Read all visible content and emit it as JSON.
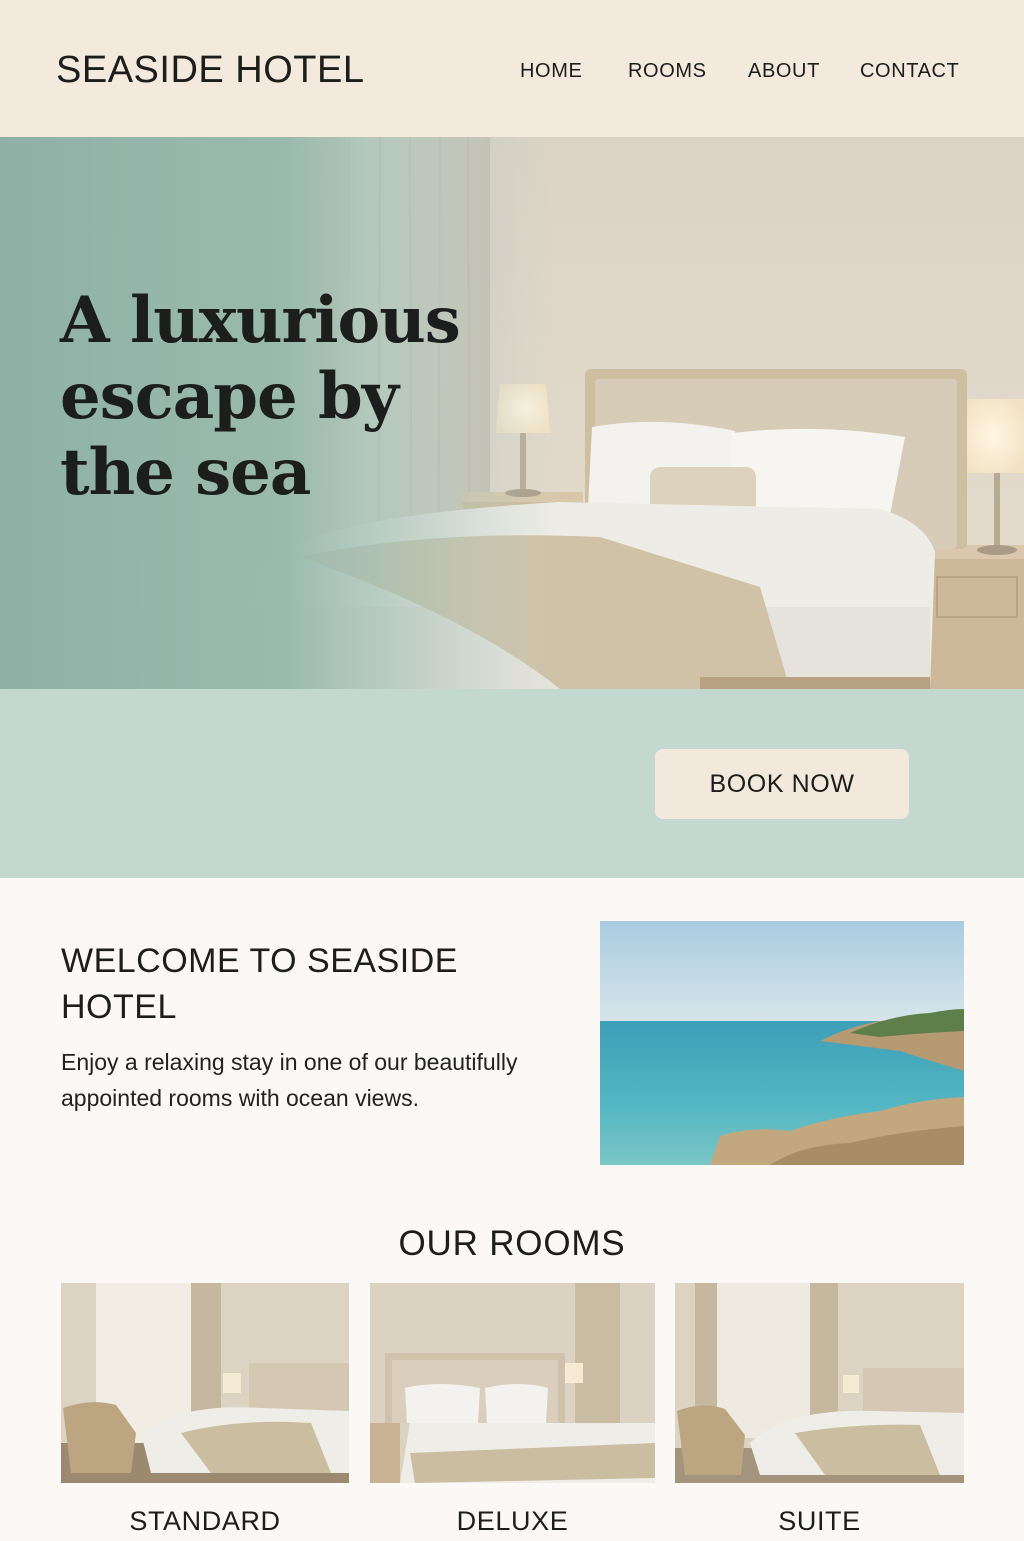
{
  "header": {
    "brand": "SEASIDE HOTEL",
    "nav": [
      "HOME",
      "ROOMS",
      "ABOUT",
      "CONTACT"
    ]
  },
  "hero": {
    "title": "A luxurious escape by the sea"
  },
  "booking": {
    "button_label": "BOOK NOW"
  },
  "welcome": {
    "title": "WELCOME TO SEASIDE HOTEL",
    "text": "Enjoy a relaxing stay in one of our beautifully appointed rooms with ocean views."
  },
  "rooms": {
    "title": "OUR ROOMS",
    "items": [
      {
        "label": "STANDARD"
      },
      {
        "label": "DELUXE"
      },
      {
        "label": "SUITE"
      }
    ]
  },
  "colors": {
    "header_bg": "#f3eadd",
    "hero_overlay": "#93b7aa",
    "band_bg": "#c3d8cf",
    "button_bg": "#f2e9dc",
    "page_bg": "#fbf8f5"
  }
}
